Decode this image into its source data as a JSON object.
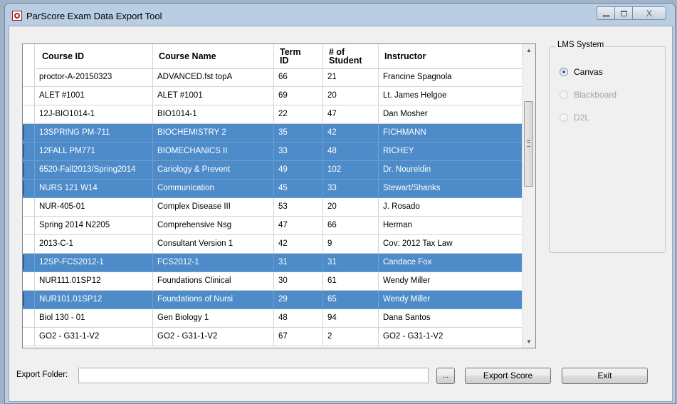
{
  "window": {
    "title": "ParScore Exam Data Export Tool",
    "close_glyph": "X"
  },
  "grid": {
    "columns": [
      "Course ID",
      "Course Name",
      "Term ID",
      "# of Student",
      "Instructor"
    ],
    "rows": [
      {
        "course_id": "proctor-A-20150323",
        "course_name": "ADVANCED.fst topA",
        "term_id": "66",
        "students": "21",
        "instructor": "Francine Spagnola",
        "selected": false
      },
      {
        "course_id": "ALET #1001",
        "course_name": "ALET #1001",
        "term_id": "69",
        "students": "20",
        "instructor": "Lt. James Helgoe",
        "selected": false
      },
      {
        "course_id": "12J-BIO1014-1",
        "course_name": "BIO1014-1",
        "term_id": "22",
        "students": "47",
        "instructor": "Dan Mosher",
        "selected": false
      },
      {
        "course_id": "13SPRING PM-711",
        "course_name": "BIOCHEMISTRY 2",
        "term_id": "35",
        "students": "42",
        "instructor": "FICHMANN",
        "selected": true
      },
      {
        "course_id": "12FALL PM771",
        "course_name": "BIOMECHANICS II",
        "term_id": "33",
        "students": "48",
        "instructor": "RICHEY",
        "selected": true
      },
      {
        "course_id": "6520-Fall2013/Spring2014",
        "course_name": "Cariology & Prevent",
        "term_id": "49",
        "students": "102",
        "instructor": "Dr. Noureldin",
        "selected": true
      },
      {
        "course_id": "NURS 121 W14",
        "course_name": "Communication",
        "term_id": "45",
        "students": "33",
        "instructor": "Stewart/Shanks",
        "selected": true
      },
      {
        "course_id": "NUR-405-01",
        "course_name": "Complex Disease III",
        "term_id": "53",
        "students": "20",
        "instructor": "J. Rosado",
        "selected": false
      },
      {
        "course_id": "Spring 2014 N2205",
        "course_name": "Comprehensive Nsg",
        "term_id": "47",
        "students": "66",
        "instructor": "Herman",
        "selected": false
      },
      {
        "course_id": "2013-C-1",
        "course_name": "Consultant Version 1",
        "term_id": "42",
        "students": "9",
        "instructor": "Cov: 2012 Tax Law",
        "selected": false
      },
      {
        "course_id": "12SP-FCS2012-1",
        "course_name": "FCS2012-1",
        "term_id": "31",
        "students": "31",
        "instructor": "Candace Fox",
        "selected": true
      },
      {
        "course_id": "NUR111.01SP12",
        "course_name": "Foundations Clinical",
        "term_id": "30",
        "students": "61",
        "instructor": "Wendy Miller",
        "selected": false
      },
      {
        "course_id": "NUR101.01SP12",
        "course_name": "Foundations of Nursi",
        "term_id": "29",
        "students": "65",
        "instructor": "Wendy Miller",
        "selected": true
      },
      {
        "course_id": "Biol 130 - 01",
        "course_name": "Gen Biology 1",
        "term_id": "48",
        "students": "94",
        "instructor": "Dana Santos",
        "selected": false
      },
      {
        "course_id": "GO2 - G31-1-V2",
        "course_name": "GO2 - G31-1-V2",
        "term_id": "67",
        "students": "2",
        "instructor": "GO2 - G31-1-V2",
        "selected": false
      }
    ]
  },
  "lms": {
    "title": "LMS System",
    "options": [
      {
        "label": "Canvas",
        "checked": true,
        "enabled": true
      },
      {
        "label": "Blackboard",
        "checked": false,
        "enabled": false
      },
      {
        "label": "D2L",
        "checked": false,
        "enabled": false
      }
    ]
  },
  "export": {
    "label": "Export Folder:",
    "value": "",
    "browse_label": "...",
    "export_button": "Export Score",
    "exit_button": "Exit"
  },
  "colors": {
    "selection": "#4d8bc9",
    "window_frame": "#b9cde3"
  }
}
